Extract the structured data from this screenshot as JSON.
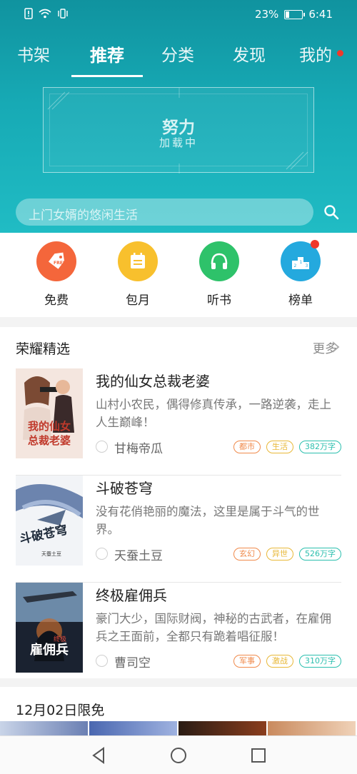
{
  "status": {
    "battery": "23%",
    "time": "6:41",
    "battery_level": 0.23
  },
  "tabs": [
    {
      "label": "书架"
    },
    {
      "label": "推荐"
    },
    {
      "label": "分类"
    },
    {
      "label": "发现"
    },
    {
      "label": "我的"
    }
  ],
  "banner": {
    "title": "努力",
    "subtitle": "加载中"
  },
  "search": {
    "placeholder": "上门女婿的悠闲生活"
  },
  "quick": [
    {
      "label": "免费",
      "color": "#f4663b",
      "icon": "free-tag-icon"
    },
    {
      "label": "包月",
      "color": "#f8c02d",
      "icon": "calendar-icon"
    },
    {
      "label": "听书",
      "color": "#2ec26a",
      "icon": "headphones-icon"
    },
    {
      "label": "榜单",
      "color": "#24a9de",
      "icon": "podium-icon"
    }
  ],
  "featured": {
    "title": "荣耀精选",
    "more": "更多",
    "books": [
      {
        "title": "我的仙女总裁老婆",
        "desc": "山村小农民，偶得修真传承，一路逆袭，走上人生巅峰！",
        "author": "甘梅帝瓜",
        "cover_text": "我的仙女总裁老婆",
        "tags": [
          {
            "text": "都市",
            "color": "#f08a4b"
          },
          {
            "text": "生活",
            "color": "#e8b838"
          },
          {
            "text": "382万字",
            "color": "#2bbfae"
          }
        ]
      },
      {
        "title": "斗破苍穹",
        "desc": "没有花俏艳丽的魔法，这里是属于斗气的世界。",
        "author": "天蚕土豆",
        "cover_text": "斗破苍穹",
        "tags": [
          {
            "text": "玄幻",
            "color": "#f08a4b"
          },
          {
            "text": "异世",
            "color": "#e8b838"
          },
          {
            "text": "526万字",
            "color": "#2bbfae"
          }
        ]
      },
      {
        "title": "终极雇佣兵",
        "desc": "豪门大少，国际财阀，神秘的古武者，在雇佣兵之王面前，全都只有跪着唱征服！",
        "author": "曹司空",
        "cover_text": "雇佣兵",
        "tags": [
          {
            "text": "军事",
            "color": "#f08a4b"
          },
          {
            "text": "激战",
            "color": "#e8b838"
          },
          {
            "text": "310万字",
            "color": "#2bbfae"
          }
        ]
      }
    ]
  },
  "limited": {
    "title": "12月02日限免"
  }
}
